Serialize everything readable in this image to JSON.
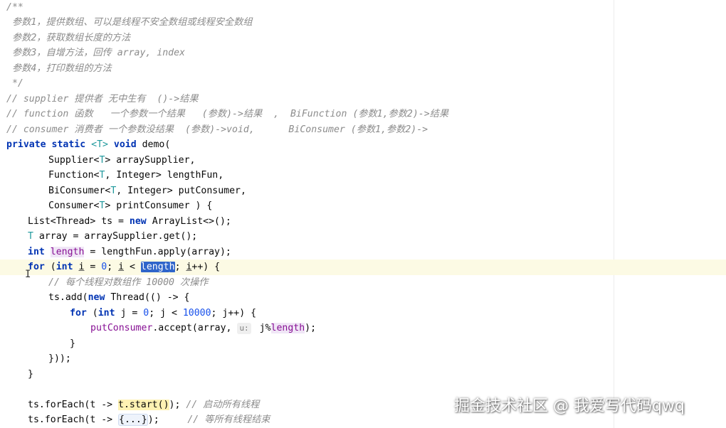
{
  "editor": {
    "lines": {
      "l1": "/**",
      "l2": " 参数1，提供数组、可以是线程不安全数组或线程安全数组",
      "l3": " 参数2，获取数组长度的方法",
      "l4": " 参数3，自增方法，回传 array, index",
      "l5": " 参数4，打印数组的方法",
      "l6": " */",
      "l7": "// supplier 提供者 无中生有  ()->结果",
      "l8": "// function 函数   一个参数一个结果   (参数)->结果  ,  BiFunction (参数1,参数2)->结果",
      "l9": "// consumer 消费者 一个参数没结果  (参数)->void,      BiConsumer (参数1,参数2)->",
      "l10": {
        "kw1": "private",
        "kw2": "static",
        "gen": "<T>",
        "kw3": "void",
        "rest": " demo("
      },
      "l11": {
        "a": "Supplier<",
        "t": "T",
        "b": "> arraySupplier,"
      },
      "l12": {
        "a": "Function<",
        "t": "T",
        "b": ", Integer> lengthFun,"
      },
      "l13": {
        "a": "BiConsumer<",
        "t": "T",
        "b": ", Integer> putConsumer,"
      },
      "l14": {
        "a": "Consumer<",
        "t": "T",
        "b": "> printConsumer ) {"
      },
      "l15": {
        "a": "List<Thread> ts = ",
        "kw": "new",
        "b": " ArrayList<>();"
      },
      "l16": {
        "t": "T",
        "b": " array = arraySupplier.get();"
      },
      "l17": {
        "kw": "int",
        "var": "length",
        "b": " = lengthFun.apply(array);"
      },
      "l18": {
        "kw1": "for",
        "p1": " (",
        "kw2": "int",
        "sp": " ",
        "i1": "i",
        "p2": " = ",
        "n0": "0",
        "p3": "; ",
        "i2": "i",
        "p4": " < ",
        "sel1": "lengt",
        "sel2": "h",
        "p5": "; ",
        "i3": "i",
        "p6": "++) {"
      },
      "l19": "// 每个线程对数组作 10000 次操作",
      "l20": {
        "a": "ts.add(",
        "kw": "new",
        "b": " Thread(() -> {"
      },
      "l21": {
        "kw1": "for",
        "p1": " (",
        "kw2": "int",
        "p2": " j = ",
        "n0": "0",
        "p3": "; j < ",
        "n1": "10000",
        "p4": "; j++) {"
      },
      "l22": {
        "fn": "putConsumer",
        "a": ".accept(array, ",
        "hint": "u:",
        "b": " j%",
        "var": "length",
        "c": ");"
      },
      "l23": "}",
      "l24": "}));",
      "l25": "}",
      "l27": {
        "a": "ts.forEach(t -> ",
        "m": "t.start()",
        "b": "); ",
        "c": "// 启动所有线程"
      },
      "l28": {
        "a": "ts.forEach(t -> ",
        "f": "{...}",
        "b": ");     ",
        "c": "// 等所有线程结束"
      }
    }
  },
  "watermark": "掘金技术社区 @ 我爱写代码qwq",
  "colors": {
    "keyword": "#0033b3",
    "comment": "#8c8c8c",
    "type_param": "#20999d",
    "number": "#1750eb",
    "field": "#871094",
    "selection": "#2f65ca",
    "current_line": "#fcfae4"
  },
  "icons": {
    "text_cursor": "i-beam-cursor-icon"
  }
}
